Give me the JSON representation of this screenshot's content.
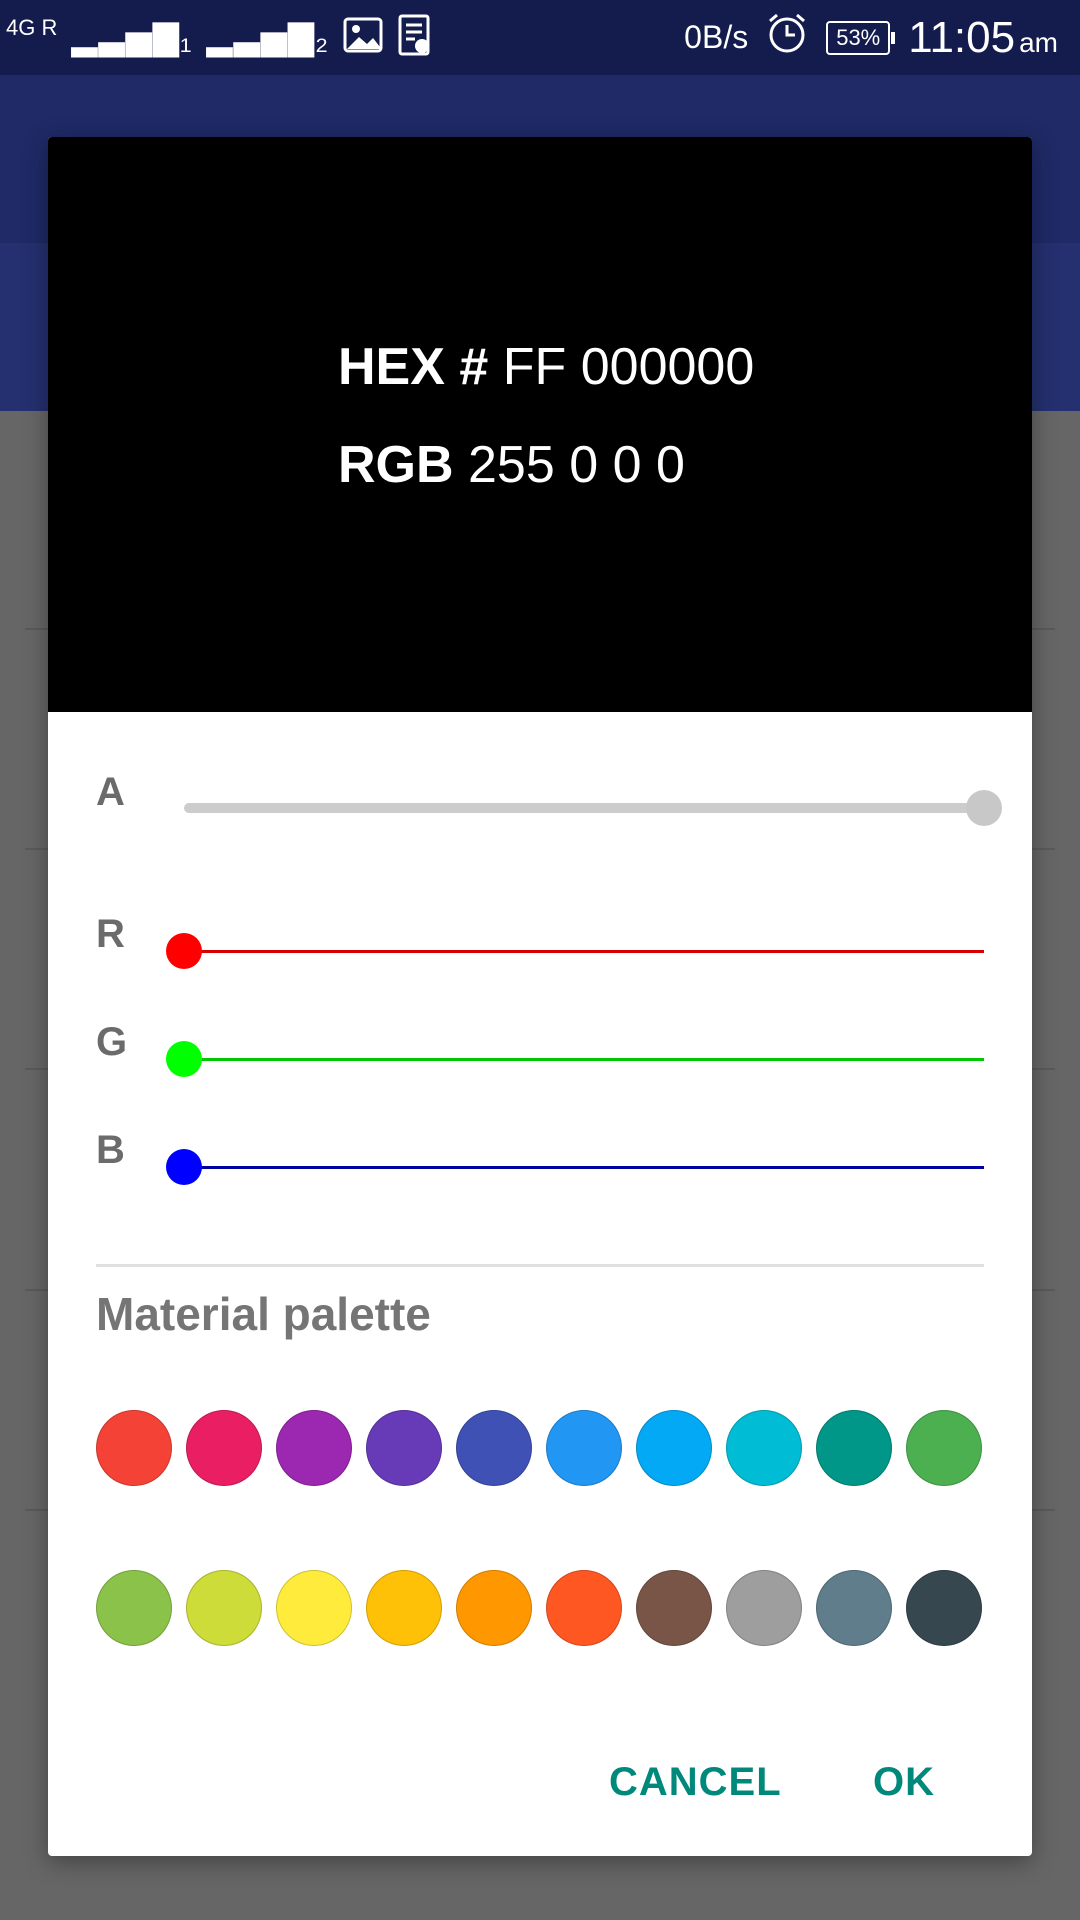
{
  "status_bar": {
    "network": "4G R",
    "signal_1": "▂▃▅▇₁",
    "signal_2": "▂▃▅▇₂",
    "icons": [
      "image-icon",
      "notes-icon",
      "alarm-clock-icon"
    ],
    "speed": "0B/s",
    "battery": "53%",
    "time": "11:05",
    "ampm": "am"
  },
  "dialog": {
    "preview": {
      "hex_label": "HEX",
      "hex_hash": "#",
      "hex_value": "FF 000000",
      "rgb_label": "RGB",
      "rgb_value": "255 0 0 0",
      "color": "#000000"
    },
    "sliders": [
      {
        "label": "A",
        "value": 255,
        "max": 255,
        "track_color": "#cccccc",
        "thumb_color": "#c8c8c8"
      },
      {
        "label": "R",
        "value": 0,
        "max": 255,
        "track_color": "#d50000",
        "thumb_color": "#ff0000"
      },
      {
        "label": "G",
        "value": 0,
        "max": 255,
        "track_color": "#00c800",
        "thumb_color": "#00ff00"
      },
      {
        "label": "B",
        "value": 0,
        "max": 255,
        "track_color": "#0000a0",
        "thumb_color": "#0000ff"
      }
    ],
    "palette_title": "Material palette",
    "palette": [
      [
        "#f44336",
        "#e91e63",
        "#9c27b0",
        "#673ab7",
        "#3f51b5",
        "#2196f3",
        "#03a9f4",
        "#00bcd4",
        "#009688",
        "#4caf50"
      ],
      [
        "#8bc34a",
        "#cddc39",
        "#ffeb3b",
        "#ffc107",
        "#ff9800",
        "#ff5722",
        "#795548",
        "#9e9e9e",
        "#607d8b",
        "#37474f"
      ]
    ],
    "cancel_label": "CANCEL",
    "ok_label": "OK"
  }
}
